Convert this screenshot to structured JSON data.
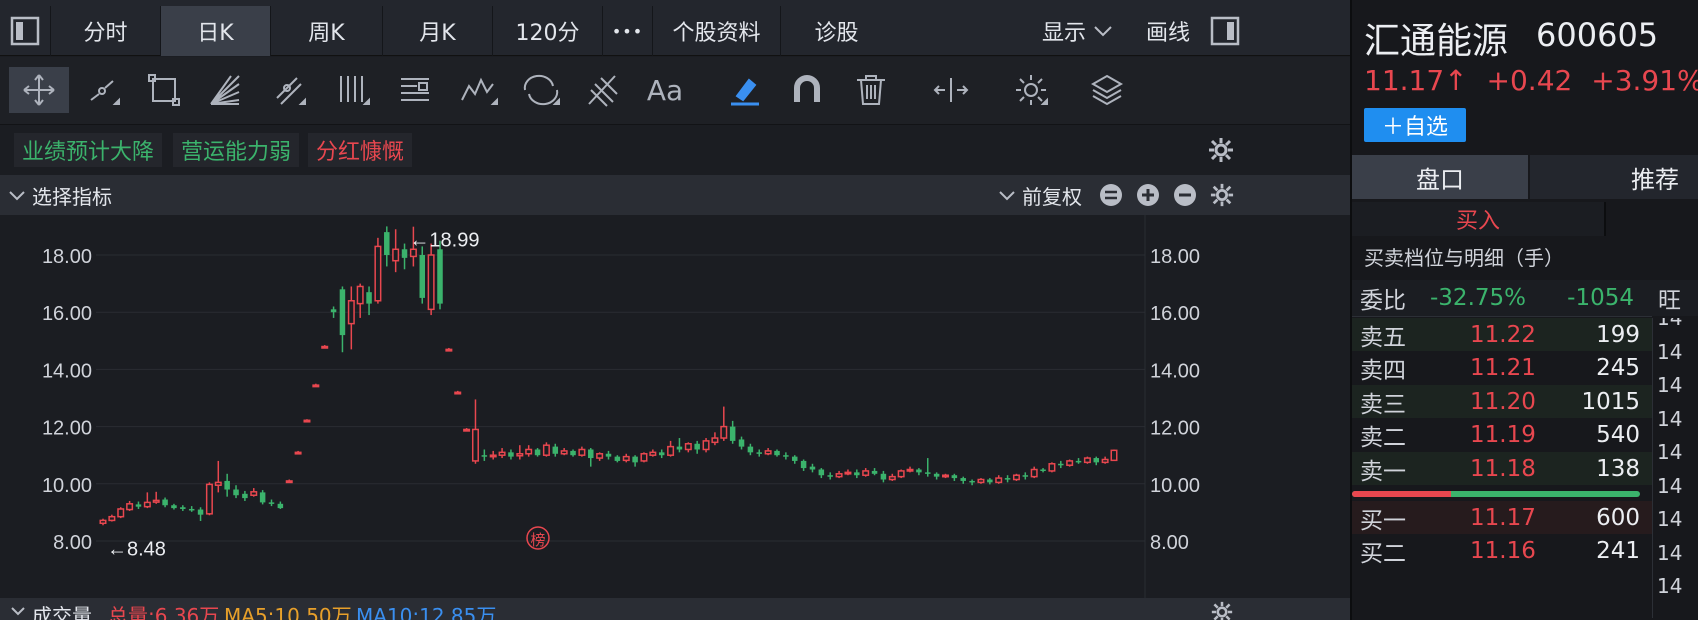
{
  "tabs": [
    "分时",
    "日K",
    "周K",
    "月K",
    "120分"
  ],
  "tab_more": "•••",
  "tab_profile": "个股资料",
  "tab_diagnose": "诊股",
  "tab_display": "显示",
  "tab_draw": "画线",
  "tags": [
    {
      "text": "业绩预计大降",
      "color": "#3bb36c"
    },
    {
      "text": "营运能力弱",
      "color": "#3bb36c"
    },
    {
      "text": "分红慷慨",
      "color": "#e8474f"
    }
  ],
  "indicator_select": "选择指标",
  "adjust_mode": "前复权",
  "chart_data": {
    "type": "candlestick",
    "ylim": [
      8,
      19.5
    ],
    "yticks": [
      "8.00",
      "10.00",
      "12.00",
      "14.00",
      "16.00",
      "18.00"
    ],
    "annotations": [
      {
        "text": "←18.99",
        "value": 18.99
      },
      {
        "text": "←8.48",
        "value": 8.48
      }
    ],
    "badge": "榜",
    "candles": [
      [
        8.62,
        8.72,
        8.55,
        8.78
      ],
      [
        8.72,
        8.85,
        8.68,
        8.92
      ],
      [
        8.85,
        9.12,
        8.8,
        9.18
      ],
      [
        9.1,
        9.3,
        9.05,
        9.4
      ],
      [
        9.28,
        9.2,
        9.12,
        9.38
      ],
      [
        9.2,
        9.35,
        9.15,
        9.7
      ],
      [
        9.36,
        9.42,
        9.3,
        9.72
      ],
      [
        9.45,
        9.25,
        9.18,
        9.52
      ],
      [
        9.25,
        9.15,
        9.1,
        9.3
      ],
      [
        9.18,
        9.12,
        9.05,
        9.25
      ],
      [
        9.12,
        9.1,
        9.02,
        9.22
      ],
      [
        9.1,
        8.92,
        8.7,
        9.18
      ],
      [
        8.95,
        9.98,
        8.9,
        10.05
      ],
      [
        9.95,
        10.05,
        9.7,
        10.8
      ],
      [
        10.1,
        9.8,
        9.55,
        10.35
      ],
      [
        9.8,
        9.6,
        9.5,
        9.95
      ],
      [
        9.65,
        9.5,
        9.4,
        9.75
      ],
      [
        9.6,
        9.72,
        9.55,
        9.85
      ],
      [
        9.7,
        9.35,
        9.28,
        9.78
      ],
      [
        9.35,
        9.3,
        9.22,
        9.45
      ],
      [
        9.3,
        9.15,
        9.12,
        9.38
      ],
      [
        10.1,
        10.1,
        10.05,
        10.15
      ],
      [
        11.1,
        11.1,
        11.05,
        11.15
      ],
      [
        12.22,
        12.22,
        12.18,
        12.26
      ],
      [
        13.45,
        13.45,
        13.4,
        13.5
      ],
      [
        14.8,
        14.8,
        14.75,
        14.85
      ],
      [
        16.1,
        16.0,
        15.8,
        16.2
      ],
      [
        16.8,
        15.2,
        14.6,
        16.9
      ],
      [
        15.6,
        16.4,
        14.7,
        16.9
      ],
      [
        16.3,
        16.9,
        15.8,
        17.0
      ],
      [
        16.7,
        16.3,
        15.9,
        16.9
      ],
      [
        16.4,
        18.3,
        16.3,
        18.6
      ],
      [
        18.8,
        18.0,
        17.6,
        19.0
      ],
      [
        17.8,
        18.2,
        17.4,
        18.9
      ],
      [
        18.2,
        17.9,
        17.5,
        18.4
      ],
      [
        17.95,
        18.2,
        17.6,
        18.99
      ],
      [
        18.0,
        16.5,
        16.3,
        18.3
      ],
      [
        16.1,
        18.0,
        15.9,
        18.4
      ],
      [
        18.2,
        16.3,
        16.1,
        18.5
      ],
      [
        14.7,
        14.7,
        14.65,
        14.75
      ],
      [
        13.2,
        13.2,
        13.15,
        13.25
      ],
      [
        11.9,
        11.9,
        11.85,
        11.95
      ],
      [
        10.8,
        11.9,
        10.7,
        12.95
      ],
      [
        11.0,
        10.95,
        10.8,
        11.2
      ],
      [
        10.95,
        11.0,
        10.85,
        11.15
      ],
      [
        11.0,
        11.1,
        10.9,
        11.25
      ],
      [
        11.1,
        10.95,
        10.85,
        11.2
      ],
      [
        10.98,
        11.05,
        10.85,
        11.35
      ],
      [
        11.05,
        11.2,
        10.95,
        11.35
      ],
      [
        11.2,
        11.0,
        10.95,
        11.25
      ],
      [
        11.0,
        11.35,
        10.95,
        11.45
      ],
      [
        11.3,
        11.05,
        10.95,
        11.4
      ],
      [
        11.05,
        11.15,
        11.0,
        11.25
      ],
      [
        11.15,
        11.0,
        10.95,
        11.2
      ],
      [
        11.0,
        11.2,
        10.95,
        11.3
      ],
      [
        11.2,
        10.9,
        10.6,
        11.25
      ],
      [
        10.9,
        11.05,
        10.8,
        11.1
      ],
      [
        11.05,
        10.95,
        10.85,
        11.15
      ],
      [
        10.95,
        10.8,
        10.75,
        11.0
      ],
      [
        10.82,
        10.95,
        10.75,
        11.05
      ],
      [
        10.95,
        10.75,
        10.6,
        11.0
      ],
      [
        10.8,
        11.05,
        10.75,
        11.1
      ],
      [
        11.0,
        11.1,
        10.95,
        11.2
      ],
      [
        11.1,
        11.0,
        10.9,
        11.2
      ],
      [
        11.0,
        11.3,
        10.95,
        11.5
      ],
      [
        11.3,
        11.2,
        11.1,
        11.6
      ],
      [
        11.2,
        11.4,
        11.1,
        11.45
      ],
      [
        11.4,
        11.2,
        11.05,
        11.5
      ],
      [
        11.2,
        11.5,
        11.1,
        11.6
      ],
      [
        11.45,
        11.6,
        11.35,
        11.8
      ],
      [
        11.6,
        12.0,
        11.5,
        12.7
      ],
      [
        12.0,
        11.5,
        11.4,
        12.2
      ],
      [
        11.55,
        11.3,
        11.2,
        11.65
      ],
      [
        11.3,
        11.1,
        11.0,
        11.4
      ],
      [
        11.1,
        11.05,
        10.95,
        11.2
      ],
      [
        11.05,
        11.15,
        11.0,
        11.25
      ],
      [
        11.15,
        11.0,
        10.95,
        11.2
      ],
      [
        11.0,
        10.95,
        10.85,
        11.1
      ],
      [
        10.95,
        10.8,
        10.7,
        11.0
      ],
      [
        10.8,
        10.55,
        10.45,
        10.85
      ],
      [
        10.6,
        10.5,
        10.4,
        10.7
      ],
      [
        10.5,
        10.3,
        10.2,
        10.55
      ],
      [
        10.3,
        10.25,
        10.15,
        10.4
      ],
      [
        10.25,
        10.35,
        10.2,
        10.45
      ],
      [
        10.35,
        10.4,
        10.3,
        10.5
      ],
      [
        10.4,
        10.3,
        10.2,
        10.5
      ],
      [
        10.3,
        10.45,
        10.25,
        10.55
      ],
      [
        10.45,
        10.35,
        10.3,
        10.55
      ],
      [
        10.35,
        10.15,
        10.05,
        10.45
      ],
      [
        10.15,
        10.25,
        10.1,
        10.35
      ],
      [
        10.25,
        10.45,
        10.2,
        10.5
      ],
      [
        10.45,
        10.5,
        10.4,
        10.6
      ],
      [
        10.5,
        10.4,
        10.3,
        10.55
      ],
      [
        10.4,
        10.35,
        10.25,
        10.9
      ],
      [
        10.35,
        10.25,
        10.15,
        10.4
      ],
      [
        10.25,
        10.3,
        10.2,
        10.35
      ],
      [
        10.3,
        10.2,
        10.1,
        10.35
      ],
      [
        10.2,
        10.1,
        10.0,
        10.25
      ],
      [
        10.1,
        10.05,
        9.95,
        10.15
      ],
      [
        10.05,
        10.15,
        10.0,
        10.2
      ],
      [
        10.15,
        10.05,
        9.98,
        10.2
      ],
      [
        10.05,
        10.2,
        10.0,
        10.3
      ],
      [
        10.2,
        10.15,
        10.05,
        10.3
      ],
      [
        10.15,
        10.3,
        10.1,
        10.35
      ],
      [
        10.3,
        10.25,
        10.15,
        10.4
      ],
      [
        10.25,
        10.5,
        10.2,
        10.6
      ],
      [
        10.5,
        10.45,
        10.4,
        10.55
      ],
      [
        10.45,
        10.7,
        10.4,
        10.75
      ],
      [
        10.7,
        10.65,
        10.55,
        10.8
      ],
      [
        10.65,
        10.8,
        10.6,
        10.85
      ],
      [
        10.8,
        10.75,
        10.7,
        10.9
      ],
      [
        10.75,
        10.9,
        10.7,
        10.95
      ],
      [
        10.9,
        10.75,
        10.65,
        10.95
      ],
      [
        10.75,
        10.85,
        10.7,
        10.95
      ],
      [
        10.82,
        11.17,
        10.8,
        11.2
      ]
    ]
  },
  "volume_row": {
    "label": "成交量",
    "total": "总量:6.36万",
    "ma5": "MA5:10.50万",
    "ma10": "MA10:12.85万"
  },
  "stock": {
    "name": "汇通能源",
    "code": "600605",
    "price": "11.17↑",
    "change": "+0.42",
    "pct": "+3.91%",
    "watch_button": "＋自选"
  },
  "panel_tabs": [
    "盘口",
    "推荐"
  ],
  "buy_label": "买入",
  "section_title": "买卖档位与明细（手）",
  "ratio": {
    "label": "委比",
    "pct": "-32.75%",
    "diff": "-1054",
    "extra": "旺"
  },
  "asks": [
    {
      "label": "卖五",
      "price": "11.22",
      "vol": "199"
    },
    {
      "label": "卖四",
      "price": "11.21",
      "vol": "245"
    },
    {
      "label": "卖三",
      "price": "11.20",
      "vol": "1015"
    },
    {
      "label": "卖二",
      "price": "11.19",
      "vol": "540"
    },
    {
      "label": "卖一",
      "price": "11.18",
      "vol": "138"
    }
  ],
  "bids": [
    {
      "label": "买一",
      "price": "11.17",
      "vol": "600"
    },
    {
      "label": "买二",
      "price": "11.16",
      "vol": "241"
    }
  ],
  "side_digits": [
    "14",
    "14",
    "14",
    "14",
    "14",
    "14",
    "14",
    "14",
    "14"
  ]
}
